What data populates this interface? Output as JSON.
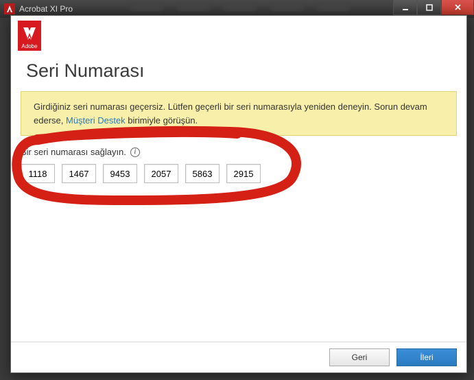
{
  "outerWindow": {
    "title": "Acrobat XI Pro"
  },
  "adobeLogo": {
    "text": "Adobe"
  },
  "dialog": {
    "title": "Seri Numarası",
    "warning": {
      "pre": "Girdiğiniz seri numarası geçersiz. Lütfen geçerli bir seri numarasıyla yeniden deneyin. Sorun devam ederse, ",
      "link": "Müşteri Destek",
      "post": " birimiyle görüşün."
    },
    "serial": {
      "label": "Bir seri numarası sağlayın.",
      "fields": [
        "1118",
        "1467",
        "9453",
        "2057",
        "5863",
        "2915"
      ]
    },
    "buttons": {
      "back": "Geri",
      "next": "İleri"
    }
  }
}
